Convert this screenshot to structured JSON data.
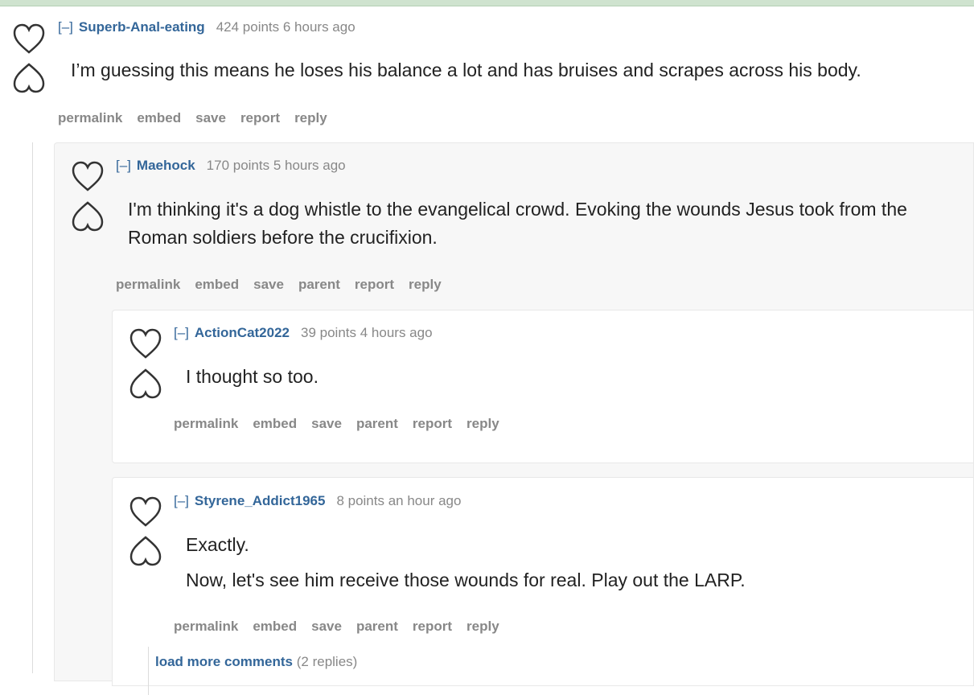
{
  "comments": [
    {
      "collapse": "[–]",
      "author": "Superb-Anal-eating",
      "meta": "424 points 6 hours ago",
      "body": [
        "I’m guessing this means he loses his balance a lot and has bruises and scrapes across his body."
      ],
      "buttons": [
        "permalink",
        "embed",
        "save",
        "report",
        "reply"
      ]
    },
    {
      "collapse": "[–]",
      "author": "Maehock",
      "meta": "170 points 5 hours ago",
      "body": [
        "I'm thinking it's a dog whistle to the evangelical crowd. Evoking the wounds Jesus took from the Roman soldiers before the crucifixion."
      ],
      "buttons": [
        "permalink",
        "embed",
        "save",
        "parent",
        "report",
        "reply"
      ]
    },
    {
      "collapse": "[–]",
      "author": "ActionCat2022",
      "meta": "39 points 4 hours ago",
      "body": [
        "I thought so too."
      ],
      "buttons": [
        "permalink",
        "embed",
        "save",
        "parent",
        "report",
        "reply"
      ]
    },
    {
      "collapse": "[–]",
      "author": "Styrene_Addict1965",
      "meta": "8 points an hour ago",
      "body": [
        "Exactly.",
        "Now, let's see him receive those wounds for real. Play out the LARP."
      ],
      "buttons": [
        "permalink",
        "embed",
        "save",
        "parent",
        "report",
        "reply"
      ]
    }
  ],
  "load_more": {
    "link": "load more comments",
    "count": "(2 replies)"
  },
  "icons": {
    "upvote": "heart-outline-icon",
    "downvote": "heart-inverted-outline-icon"
  },
  "colors": {
    "author": "#336699",
    "meta": "#888888",
    "topbar": "#cfe3cf"
  }
}
